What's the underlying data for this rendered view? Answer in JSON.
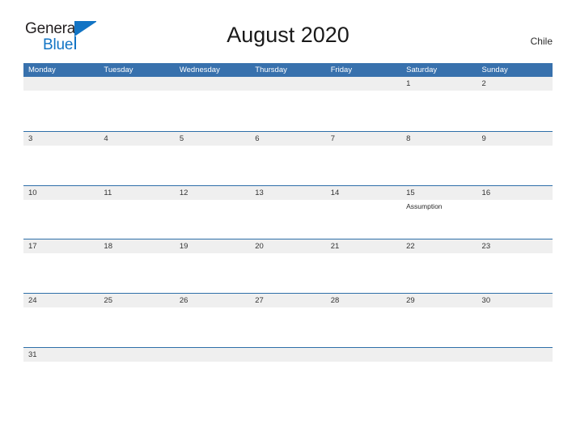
{
  "brand": {
    "word_one": "General",
    "word_two": "Blue",
    "flag_icon": "triangle-flag-icon",
    "blue_hex": "#1274c4"
  },
  "header": {
    "title": "August 2020",
    "country": "Chile"
  },
  "colors": {
    "header_blue": "#3871ad",
    "row_rule_blue": "#2e6fa9",
    "number_band_gray": "#efefef",
    "page_background": "#ffffff"
  },
  "calendar": {
    "weekday_headers": [
      "Monday",
      "Tuesday",
      "Wednesday",
      "Thursday",
      "Friday",
      "Saturday",
      "Sunday"
    ],
    "weeks": [
      {
        "days": [
          {
            "number": "",
            "event": ""
          },
          {
            "number": "",
            "event": ""
          },
          {
            "number": "",
            "event": ""
          },
          {
            "number": "",
            "event": ""
          },
          {
            "number": "",
            "event": ""
          },
          {
            "number": "1",
            "event": ""
          },
          {
            "number": "2",
            "event": ""
          }
        ]
      },
      {
        "days": [
          {
            "number": "3",
            "event": ""
          },
          {
            "number": "4",
            "event": ""
          },
          {
            "number": "5",
            "event": ""
          },
          {
            "number": "6",
            "event": ""
          },
          {
            "number": "7",
            "event": ""
          },
          {
            "number": "8",
            "event": ""
          },
          {
            "number": "9",
            "event": ""
          }
        ]
      },
      {
        "days": [
          {
            "number": "10",
            "event": ""
          },
          {
            "number": "11",
            "event": ""
          },
          {
            "number": "12",
            "event": ""
          },
          {
            "number": "13",
            "event": ""
          },
          {
            "number": "14",
            "event": ""
          },
          {
            "number": "15",
            "event": "Assumption"
          },
          {
            "number": "16",
            "event": ""
          }
        ]
      },
      {
        "days": [
          {
            "number": "17",
            "event": ""
          },
          {
            "number": "18",
            "event": ""
          },
          {
            "number": "19",
            "event": ""
          },
          {
            "number": "20",
            "event": ""
          },
          {
            "number": "21",
            "event": ""
          },
          {
            "number": "22",
            "event": ""
          },
          {
            "number": "23",
            "event": ""
          }
        ]
      },
      {
        "days": [
          {
            "number": "24",
            "event": ""
          },
          {
            "number": "25",
            "event": ""
          },
          {
            "number": "26",
            "event": ""
          },
          {
            "number": "27",
            "event": ""
          },
          {
            "number": "28",
            "event": ""
          },
          {
            "number": "29",
            "event": ""
          },
          {
            "number": "30",
            "event": ""
          }
        ]
      },
      {
        "days": [
          {
            "number": "31",
            "event": ""
          },
          {
            "number": "",
            "event": ""
          },
          {
            "number": "",
            "event": ""
          },
          {
            "number": "",
            "event": ""
          },
          {
            "number": "",
            "event": ""
          },
          {
            "number": "",
            "event": ""
          },
          {
            "number": "",
            "event": ""
          }
        ]
      }
    ]
  }
}
